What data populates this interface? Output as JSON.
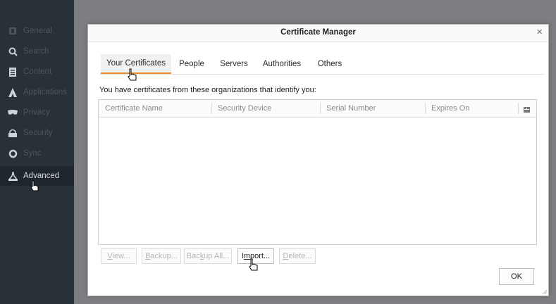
{
  "sidebar": {
    "items": [
      {
        "label": "General",
        "icon": "general-icon"
      },
      {
        "label": "Search",
        "icon": "search-icon"
      },
      {
        "label": "Content",
        "icon": "content-icon"
      },
      {
        "label": "Applications",
        "icon": "applications-icon"
      },
      {
        "label": "Privacy",
        "icon": "privacy-icon"
      },
      {
        "label": "Security",
        "icon": "security-icon"
      },
      {
        "label": "Sync",
        "icon": "sync-icon"
      },
      {
        "label": "Advanced",
        "icon": "advanced-icon",
        "active": true
      }
    ]
  },
  "dialog": {
    "title": "Certificate Manager",
    "close": "×",
    "tabs": [
      "Your Certificates",
      "People",
      "Servers",
      "Authorities",
      "Others"
    ],
    "active_tab": "Your Certificates",
    "description": "You have certificates from these organizations that identify you:",
    "table": {
      "columns": [
        "Certificate Name",
        "Security Device",
        "Serial Number",
        "Expires On"
      ],
      "rows": []
    },
    "buttons": {
      "view_pre": "",
      "view_u": "V",
      "view_post": "iew...",
      "backup_pre": "",
      "backup_u": "B",
      "backup_post": "ackup...",
      "backup_all_pre": "Bac",
      "backup_all_u": "k",
      "backup_all_post": "up All...",
      "import_pre": "I",
      "import_u": "m",
      "import_post": "port...",
      "delete_pre": "",
      "delete_u": "D",
      "delete_post": "elete...",
      "ok": "OK"
    }
  },
  "colors": {
    "accent": "#e88a2b",
    "sidebar_bg": "#283038",
    "backdrop": "#7c7e82"
  }
}
